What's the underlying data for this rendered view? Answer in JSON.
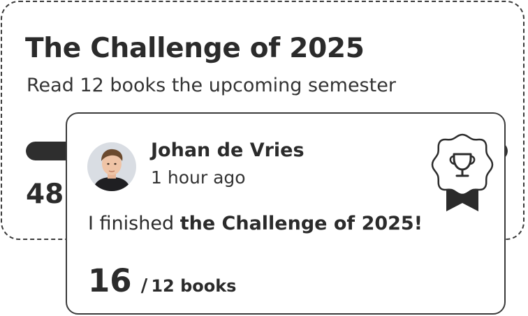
{
  "challenge": {
    "title": "The Challenge of 2025",
    "subtitle": "Read 12 books the upcoming semester",
    "count_visible": "48",
    "progress_color": "#2e2e2e"
  },
  "notification": {
    "user_name": "Johan de Vries",
    "time_ago": "1 hour ago",
    "message_prefix": "I finished ",
    "message_bold": "the Challenge of 2025!",
    "books_read": "16",
    "separator": "/",
    "books_goal": "12 books",
    "avatar_icon": "user-avatar",
    "badge_icon": "trophy-award-badge-icon"
  }
}
